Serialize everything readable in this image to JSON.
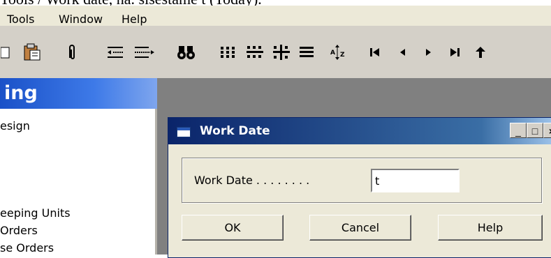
{
  "caption": "Tools / Work date, ha. sisestame t (Today).",
  "menubar": {
    "items": [
      "Tools",
      "Window",
      "Help"
    ]
  },
  "toolbar": {
    "icons": [
      "copy-icon",
      "paste-icon",
      "paperclip-icon",
      "outdent-icon",
      "indent-icon",
      "find-icon",
      "sort-icon",
      "filter-icon",
      "field-filter-icon",
      "list-icon",
      "az-sort-icon",
      "first-record-icon",
      "previous-record-icon",
      "next-record-icon",
      "last-record-icon",
      "up-icon"
    ]
  },
  "panel": {
    "title": "ing",
    "items": [
      "esign",
      "eeping Units",
      "Orders",
      "se Orders"
    ]
  },
  "dialog": {
    "title": "Work Date",
    "minimize_glyph": "_",
    "maximize_glyph": "□",
    "close_glyph": "×",
    "field_label": "Work Date . . . . . . . .",
    "field_value": "t",
    "ok_label": "OK",
    "cancel_label": "Cancel",
    "help_label": "Help"
  },
  "colors": {
    "title_bar": "#0a246a",
    "panel_header": "#1a51c8",
    "dialog_bg": "#ece9d8",
    "desktop": "#808080"
  }
}
